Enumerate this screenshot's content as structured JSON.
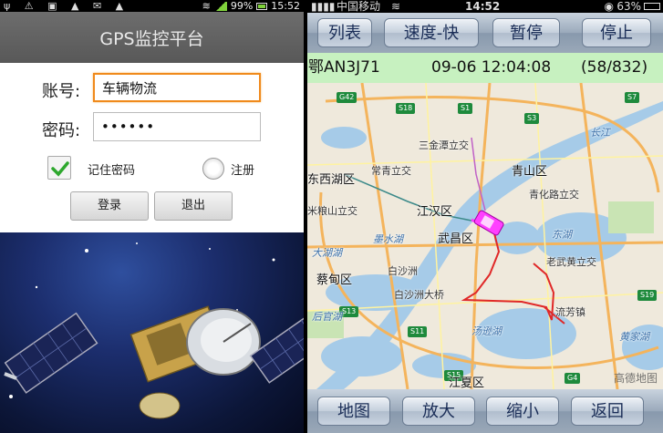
{
  "left_app": {
    "status_bar": {
      "battery_percent": "99%",
      "time": "15:52"
    },
    "title": "GPS监控平台",
    "account_label": "账号:",
    "account_value": "车辆物流",
    "password_label": "密码:",
    "password_value": "••••••",
    "remember_label": "记住密码",
    "remember_checked": true,
    "register_label": "注册",
    "login_button": "登录",
    "exit_button": "退出"
  },
  "right_app": {
    "status_bar": {
      "carrier": "中国移动",
      "time": "14:52",
      "battery_percent": "63%"
    },
    "toolbar": {
      "list_button": "列表",
      "speed_button": "速度-快",
      "pause_button": "暂停",
      "stop_button": "停止"
    },
    "info": {
      "plate": "鄂AN3J71",
      "datetime": "09-06 12:04:08",
      "progress": "(58/832)"
    },
    "map": {
      "districts": [
        "江汉区",
        "武昌区",
        "青山区",
        "蔡甸区",
        "江夏区",
        "东西湖区"
      ],
      "places": [
        "三金潭立交",
        "常青立交",
        "米粮山立交",
        "青化路立交",
        "老武黄立交",
        "流芳镇",
        "白沙洲大桥",
        "白沙洲"
      ],
      "waters": [
        "后官湖",
        "汤逊湖",
        "东湖",
        "墨水湖",
        "大湖湖",
        "长江",
        "黄家湖"
      ],
      "road_shields": [
        "G42",
        "S18",
        "S1",
        "S3",
        "S13",
        "S11",
        "S7",
        "S15",
        "G4",
        "S19"
      ],
      "watermark": "高德地图"
    },
    "bottombar": {
      "map_button": "地图",
      "zoom_in_button": "放大",
      "zoom_out_button": "缩小",
      "back_button": "返回"
    }
  }
}
